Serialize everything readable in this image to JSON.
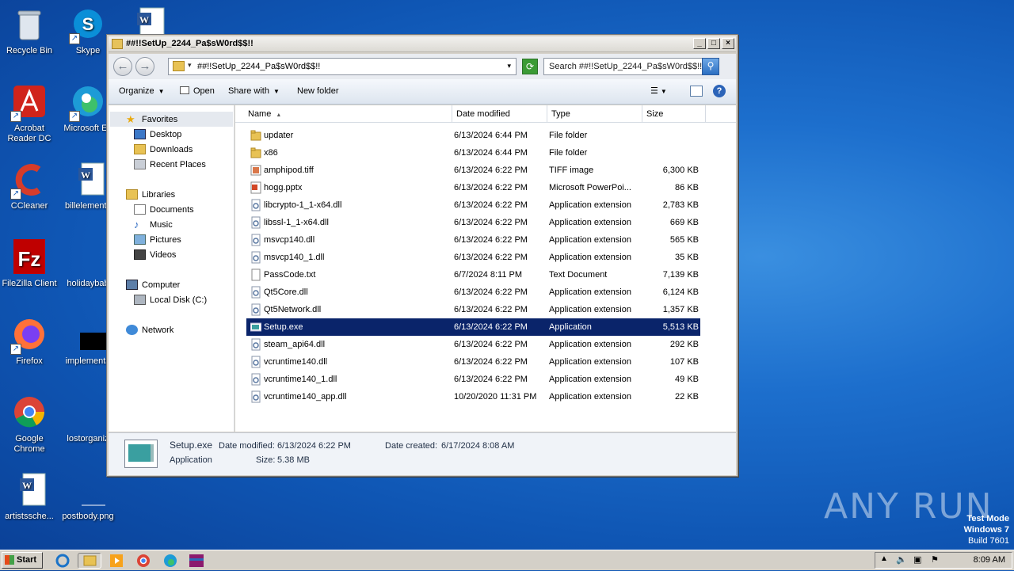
{
  "desktop": {
    "icons": [
      {
        "label": "Recycle Bin"
      },
      {
        "label": "Skype"
      },
      {
        "label": "Acrobat Reader DC"
      },
      {
        "label": "Microsoft Ed"
      },
      {
        "label": "CCleaner"
      },
      {
        "label": "billelements"
      },
      {
        "label": "FileZilla Client"
      },
      {
        "label": "holidaybab"
      },
      {
        "label": "Firefox"
      },
      {
        "label": "implementa"
      },
      {
        "label": "Google Chrome"
      },
      {
        "label": "lostorganiz"
      },
      {
        "label": "artistssche..."
      },
      {
        "label": "postbody.png"
      }
    ]
  },
  "window": {
    "title": "##!!SetUp_2244_Pa$sW0rd$$!!",
    "address": "##!!SetUp_2244_Pa$sW0rd$$!!",
    "search_placeholder": "Search ##!!SetUp_2244_Pa$sW0rd$$!!",
    "toolbar": {
      "organize": "Organize",
      "open": "Open",
      "share_with": "Share with",
      "new_folder": "New folder"
    },
    "nav": {
      "favorites": "Favorites",
      "desktop": "Desktop",
      "downloads": "Downloads",
      "recent_places": "Recent Places",
      "libraries": "Libraries",
      "documents": "Documents",
      "music": "Music",
      "pictures": "Pictures",
      "videos": "Videos",
      "computer": "Computer",
      "local_disk": "Local Disk (C:)",
      "network": "Network"
    },
    "columns": {
      "name": "Name",
      "date_modified": "Date modified",
      "type": "Type",
      "size": "Size"
    },
    "files": [
      {
        "name": "updater",
        "date": "6/13/2024 6:44 PM",
        "type": "File folder",
        "size": ""
      },
      {
        "name": "x86",
        "date": "6/13/2024 6:44 PM",
        "type": "File folder",
        "size": ""
      },
      {
        "name": "amphipod.tiff",
        "date": "6/13/2024 6:22 PM",
        "type": "TIFF image",
        "size": "6,300 KB"
      },
      {
        "name": "hogg.pptx",
        "date": "6/13/2024 6:22 PM",
        "type": "Microsoft PowerPoi...",
        "size": "86 KB"
      },
      {
        "name": "libcrypto-1_1-x64.dll",
        "date": "6/13/2024 6:22 PM",
        "type": "Application extension",
        "size": "2,783 KB"
      },
      {
        "name": "libssl-1_1-x64.dll",
        "date": "6/13/2024 6:22 PM",
        "type": "Application extension",
        "size": "669 KB"
      },
      {
        "name": "msvcp140.dll",
        "date": "6/13/2024 6:22 PM",
        "type": "Application extension",
        "size": "565 KB"
      },
      {
        "name": "msvcp140_1.dll",
        "date": "6/13/2024 6:22 PM",
        "type": "Application extension",
        "size": "35 KB"
      },
      {
        "name": "PassCode.txt",
        "date": "6/7/2024 8:11 PM",
        "type": "Text Document",
        "size": "7,139 KB"
      },
      {
        "name": "Qt5Core.dll",
        "date": "6/13/2024 6:22 PM",
        "type": "Application extension",
        "size": "6,124 KB"
      },
      {
        "name": "Qt5Network.dll",
        "date": "6/13/2024 6:22 PM",
        "type": "Application extension",
        "size": "1,357 KB"
      },
      {
        "name": "Setup.exe",
        "date": "6/13/2024 6:22 PM",
        "type": "Application",
        "size": "5,513 KB"
      },
      {
        "name": "steam_api64.dll",
        "date": "6/13/2024 6:22 PM",
        "type": "Application extension",
        "size": "292 KB"
      },
      {
        "name": "vcruntime140.dll",
        "date": "6/13/2024 6:22 PM",
        "type": "Application extension",
        "size": "107 KB"
      },
      {
        "name": "vcruntime140_1.dll",
        "date": "6/13/2024 6:22 PM",
        "type": "Application extension",
        "size": "49 KB"
      },
      {
        "name": "vcruntime140_app.dll",
        "date": "10/20/2020 11:31 PM",
        "type": "Application extension",
        "size": "22 KB"
      }
    ],
    "selected_file": "Setup.exe",
    "details": {
      "name": "Setup.exe",
      "modified_label": "Date modified:",
      "modified": "6/13/2024 6:22 PM",
      "created_label": "Date created:",
      "created": "6/17/2024 8:08 AM",
      "type": "Application",
      "size_label": "Size:",
      "size": "5.38 MB"
    }
  },
  "taskbar": {
    "start": "Start",
    "clock": "8:09 AM"
  },
  "watermark": {
    "line1": "Test Mode",
    "line2": "Windows 7",
    "line3": "Build 7601",
    "brand": "ANY RUN"
  }
}
